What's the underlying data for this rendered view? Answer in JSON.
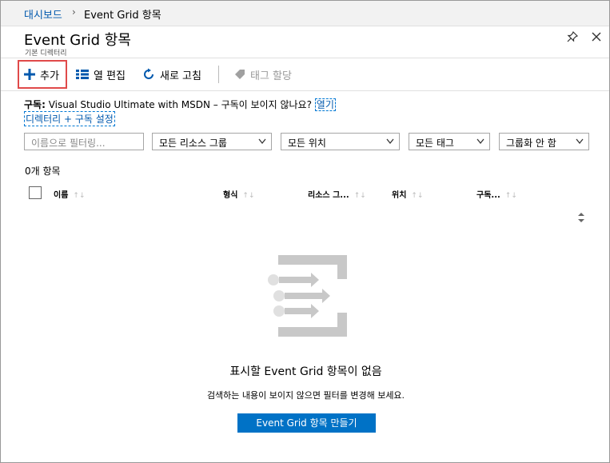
{
  "breadcrumb": {
    "home": "대시보드",
    "separator": "›",
    "current": "Event Grid 항목"
  },
  "blade": {
    "title": "Event Grid 항목",
    "subtitle": "기본 디렉터리"
  },
  "toolbar": {
    "add_label": "추가",
    "edit_columns_label": "열 편집",
    "refresh_label": "새로 고침",
    "assign_tags_label": "태그 할당"
  },
  "subscription": {
    "label": "구독:",
    "text": "Visual Studio Ultimate with MSDN – 구독이 보이지 않나요?",
    "open_link": "열기",
    "directory_link": "디렉터리 + 구독 설정"
  },
  "filters": {
    "search_placeholder": "이름으로 필터링...",
    "resource_group": "모든 리소스 그룹",
    "location": "모든 위치",
    "tags": "모든 태그",
    "grouping": "그룹화 안 함"
  },
  "list": {
    "count": "0개 항목",
    "columns": [
      "이름",
      "형식",
      "리소스 그...",
      "위치",
      "구독..."
    ]
  },
  "empty": {
    "title": "표시할 Event Grid 항목이 없음",
    "message": "검색하는 내용이 보이지 않으면 필터를 변경해 보세요.",
    "create_button": "Event Grid 항목 만들기"
  },
  "colors": {
    "accent": "#0072c6",
    "link": "#0058ad",
    "highlight_border": "#e04a4a",
    "art_gray": "#c8c8c8"
  }
}
